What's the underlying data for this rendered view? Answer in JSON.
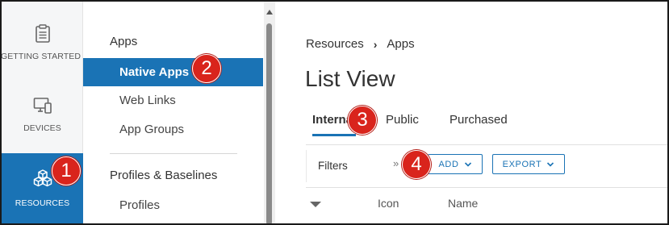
{
  "rail": {
    "items": [
      {
        "label": "GETTING STARTED",
        "icon": "clipboard-icon"
      },
      {
        "label": "DEVICES",
        "icon": "devices-icon"
      },
      {
        "label": "RESOURCES",
        "icon": "cubes-icon",
        "active": true
      }
    ]
  },
  "subnav": {
    "section_apps": "Apps",
    "items": [
      "Native Apps",
      "Web Links",
      "App Groups"
    ],
    "section_profiles": "Profiles & Baselines",
    "profiles_item": "Profiles"
  },
  "breadcrumb": {
    "root": "Resources",
    "current": "Apps"
  },
  "page": {
    "title": "List View"
  },
  "tabs": [
    "Internal",
    "Public",
    "Purchased"
  ],
  "toolbar": {
    "filters_label": "Filters",
    "collapse_glyph": "»",
    "add_label": "ADD",
    "export_label": "EXPORT"
  },
  "table": {
    "columns": [
      "Icon",
      "Name"
    ]
  },
  "callouts": [
    "1",
    "2",
    "3",
    "4"
  ],
  "colors": {
    "accent": "#1a73b5",
    "callout": "#d9241c",
    "rail_bg": "#f5f6f7"
  }
}
